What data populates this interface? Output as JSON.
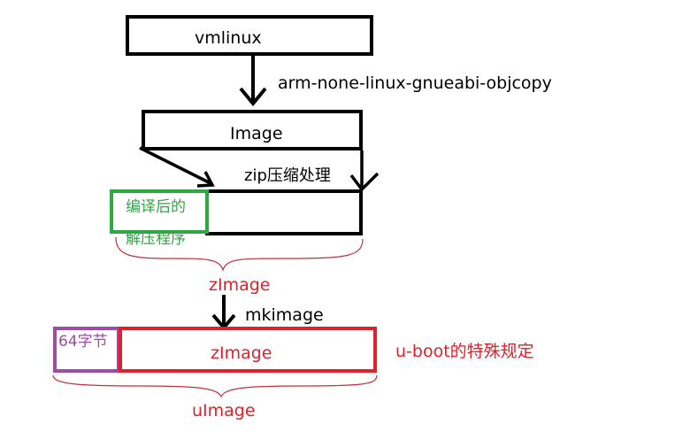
{
  "nodes": {
    "vmlinux": "vmlinux",
    "image": "Image",
    "zimage_box": "zImage"
  },
  "edges": {
    "objcopy": "arm-none-linux-gnueabi-objcopy",
    "zip": "zip压缩处理",
    "mkimage": "mkimage"
  },
  "annotations": {
    "decompressor_line1": "编译后的",
    "decompressor_line2": "解压程序",
    "zimage_brace": "zImage",
    "header_64": "64字节",
    "uboot_rule": "u-boot的特殊规定",
    "uimage_brace": "uImage"
  },
  "colors": {
    "black": "#000000",
    "green": "#2ea843",
    "red": "#e0202a",
    "purple": "#a04aa8",
    "brace_red": "#c0303a"
  }
}
